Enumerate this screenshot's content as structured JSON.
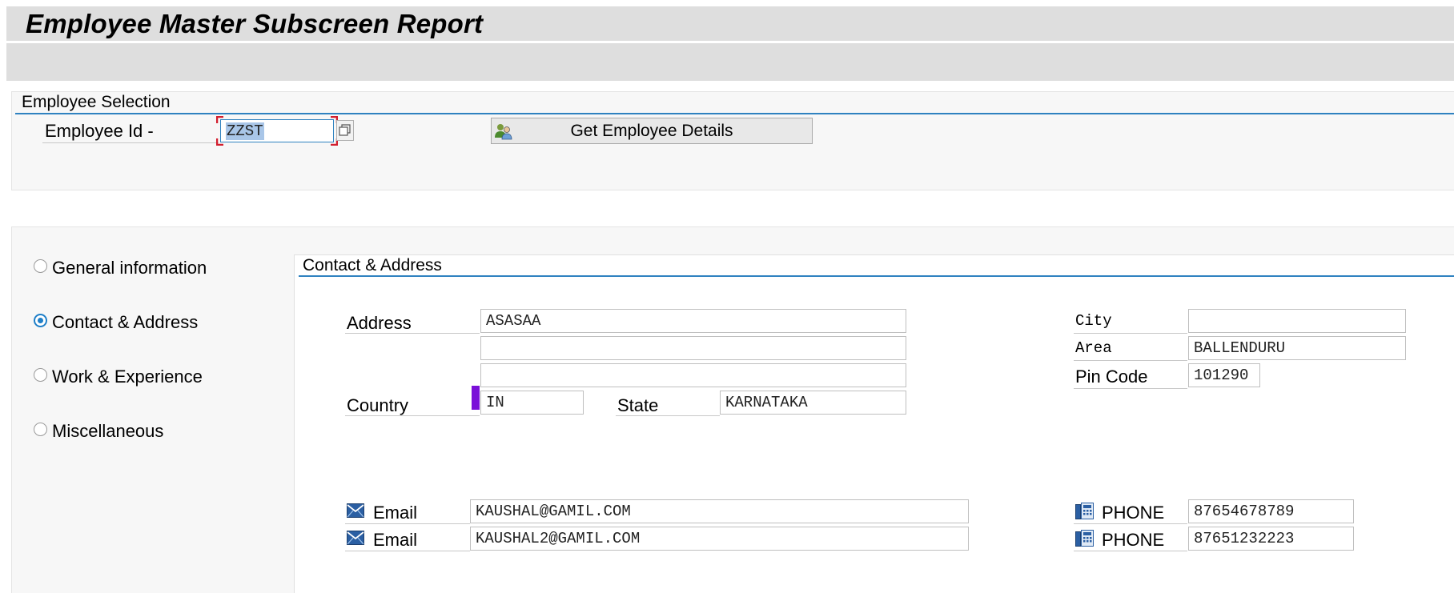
{
  "header": {
    "title": "Employee Master Subscreen Report"
  },
  "selection": {
    "group_title": "Employee Selection",
    "employee_id_label": "Employee Id -",
    "employee_id_value": "ZZST",
    "get_details_button": "Get Employee Details"
  },
  "tabs": [
    {
      "label": "General information",
      "selected": false
    },
    {
      "label": "Contact & Address",
      "selected": true
    },
    {
      "label": "Work & Experience",
      "selected": false
    },
    {
      "label": "Miscellaneous",
      "selected": false
    }
  ],
  "contact": {
    "group_title": "Contact & Address",
    "address_label": "Address",
    "address_line1": "ASASAA",
    "address_line2": "",
    "address_line3": "",
    "country_label": "Country",
    "country_value": "IN",
    "state_label": "State",
    "state_value": "KARNATAKA",
    "city_label": "City",
    "city_value": "",
    "area_label": "Area",
    "area_value": "BALLENDURU",
    "pin_label": "Pin Code",
    "pin_value": "101290",
    "emails": [
      {
        "label": "Email",
        "value": "KAUSHAL@GAMIL.COM"
      },
      {
        "label": "Email",
        "value": "KAUSHAL2@GAMIL.COM"
      }
    ],
    "phones": [
      {
        "label": "PHONE",
        "value": "87654678789"
      },
      {
        "label": "PHONE",
        "value": "87651232223"
      }
    ]
  },
  "colors": {
    "accent": "#2f82c0",
    "required_marker": "#7a10d8",
    "title_bar": "#dedede"
  }
}
